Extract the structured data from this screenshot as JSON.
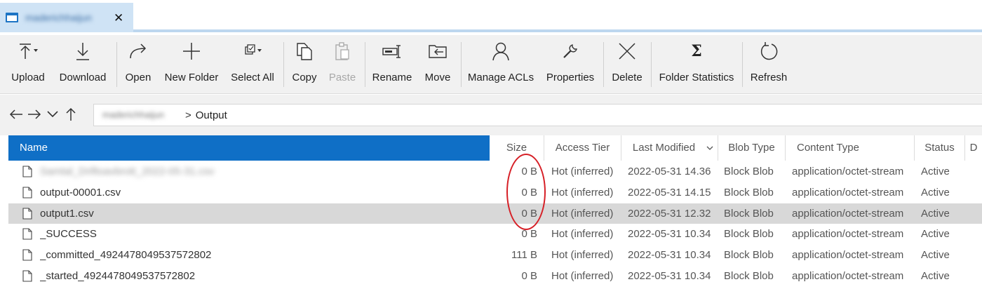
{
  "tab": {
    "title": "maderichhaijun",
    "close_glyph": "✕",
    "accent": "#1d74c4"
  },
  "toolbar": {
    "upload": "Upload",
    "download": "Download",
    "open": "Open",
    "new_folder": "New Folder",
    "select_all": "Select All",
    "copy": "Copy",
    "paste": "Paste",
    "rename": "Rename",
    "move": "Move",
    "manage_acls": "Manage ACLs",
    "properties": "Properties",
    "delete": "Delete",
    "folder_statistics": "Folder Statistics",
    "refresh": "Refresh"
  },
  "address": {
    "container": "maderichhaijun",
    "separator": ">",
    "current_folder": "Output"
  },
  "table": {
    "columns": {
      "name": "Name",
      "size": "Size",
      "access_tier": "Access Tier",
      "last_modified": "Last Modified",
      "blob_type": "Blob Type",
      "content_type": "Content Type",
      "status": "Status",
      "extra": "D"
    },
    "header_accent": "#0f6fc6",
    "rows": [
      {
        "name": "Samtal_Driftoavbrott_2022-05-31.csv",
        "size": "0 B",
        "access_tier": "Hot (inferred)",
        "last_modified": "2022-05-31 14.36",
        "blob_type": "Block Blob",
        "content_type": "application/octet-stream",
        "status": "Active"
      },
      {
        "name": "output-00001.csv",
        "size": "0 B",
        "access_tier": "Hot (inferred)",
        "last_modified": "2022-05-31 14.15",
        "blob_type": "Block Blob",
        "content_type": "application/octet-stream",
        "status": "Active"
      },
      {
        "name": "output1.csv",
        "size": "0 B",
        "access_tier": "Hot (inferred)",
        "last_modified": "2022-05-31 12.32",
        "blob_type": "Block Blob",
        "content_type": "application/octet-stream",
        "status": "Active"
      },
      {
        "name": "_SUCCESS",
        "size": "0 B",
        "access_tier": "Hot (inferred)",
        "last_modified": "2022-05-31 10.34",
        "blob_type": "Block Blob",
        "content_type": "application/octet-stream",
        "status": "Active"
      },
      {
        "name": "_committed_4924478049537572802",
        "size": "111 B",
        "access_tier": "Hot (inferred)",
        "last_modified": "2022-05-31 10.34",
        "blob_type": "Block Blob",
        "content_type": "application/octet-stream",
        "status": "Active"
      },
      {
        "name": "_started_4924478049537572802",
        "size": "0 B",
        "access_tier": "Hot (inferred)",
        "last_modified": "2022-05-31 10.34",
        "blob_type": "Block Blob",
        "content_type": "application/octet-stream",
        "status": "Active"
      }
    ],
    "annotation_color": "#d61f26"
  }
}
